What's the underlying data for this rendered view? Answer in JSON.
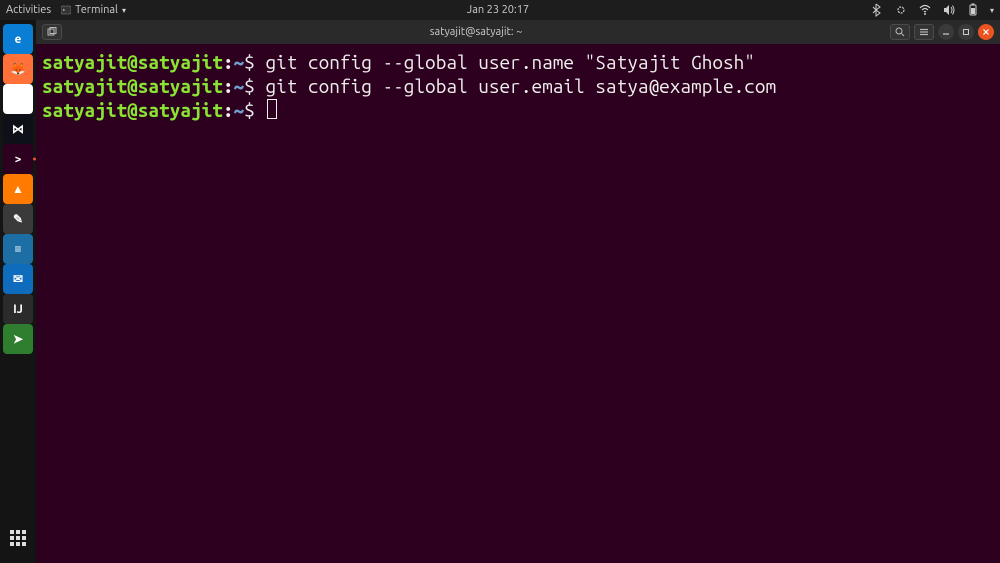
{
  "top_panel": {
    "activities_label": "Activities",
    "app_menu_label": "Terminal",
    "datetime": "Jan 23  20:17"
  },
  "dock": {
    "items": [
      {
        "name": "edge",
        "color": "#0a7dd4",
        "glyph": "e"
      },
      {
        "name": "firefox",
        "color": "#ff7139",
        "glyph": "🦊"
      },
      {
        "name": "chrome",
        "color": "#ffffff",
        "glyph": "◉"
      },
      {
        "name": "vscode",
        "color": "#0d1117",
        "glyph": "⋈"
      },
      {
        "name": "terminal",
        "color": "#2c001e",
        "glyph": ">"
      },
      {
        "name": "vlc",
        "color": "#ff7a00",
        "glyph": "▲"
      },
      {
        "name": "text-editor",
        "color": "#3a3a3a",
        "glyph": "✎"
      },
      {
        "name": "libreoffice-writer",
        "color": "#1c6ea4",
        "glyph": "≡"
      },
      {
        "name": "outlook",
        "color": "#0f6cbd",
        "glyph": "✉"
      },
      {
        "name": "intellij",
        "color": "#2b2b2b",
        "glyph": "IJ"
      },
      {
        "name": "pycharm",
        "color": "#2f7d2f",
        "glyph": "➤"
      }
    ]
  },
  "titlebar": {
    "title": "satyajit@satyajit: ~"
  },
  "terminal": {
    "prompt_user": "satyajit@satyajit",
    "prompt_colon": ":",
    "prompt_path": "~",
    "prompt_symbol": "$",
    "lines": [
      {
        "command": "git config --global user.name \"Satyajit Ghosh\""
      },
      {
        "command": "git config --global user.email satya@example.com"
      },
      {
        "command": "",
        "cursor": true
      }
    ]
  }
}
